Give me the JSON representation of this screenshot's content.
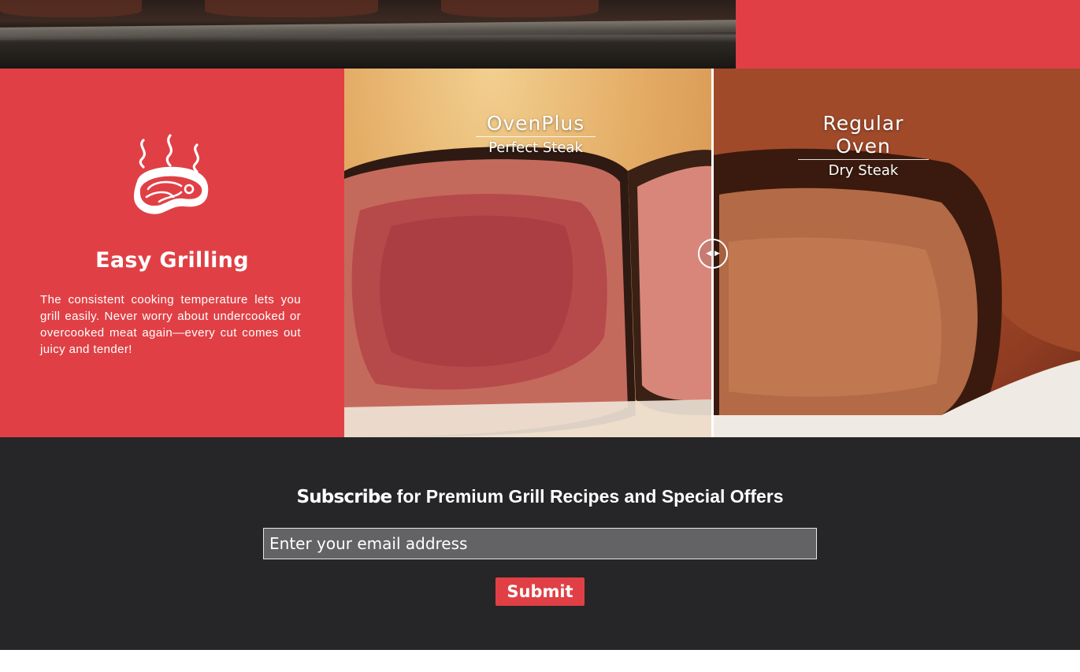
{
  "colors": {
    "brand_red": "#e04045",
    "dark_bg": "#262628",
    "input_bg": "#636366"
  },
  "feature": {
    "icon": "steak-icon",
    "title": "Easy Grilling",
    "description": "The consistent cooking temperature lets you grill easily. Never worry about undercooked or overcooked meat again—every cut comes out juicy and tender!"
  },
  "comparison": {
    "left": {
      "title": "OvenPlus",
      "subtitle": "Perfect Steak"
    },
    "right": {
      "title": "Regular Oven",
      "subtitle": "Dry Steak"
    },
    "handle_icon": "drag-arrows-icon"
  },
  "subscribe": {
    "heading_bold": "Subscribe",
    "heading_rest": " for Premium Grill Recipes and Special Offers",
    "email_placeholder": "Enter your email address",
    "submit_label": "Submit"
  }
}
